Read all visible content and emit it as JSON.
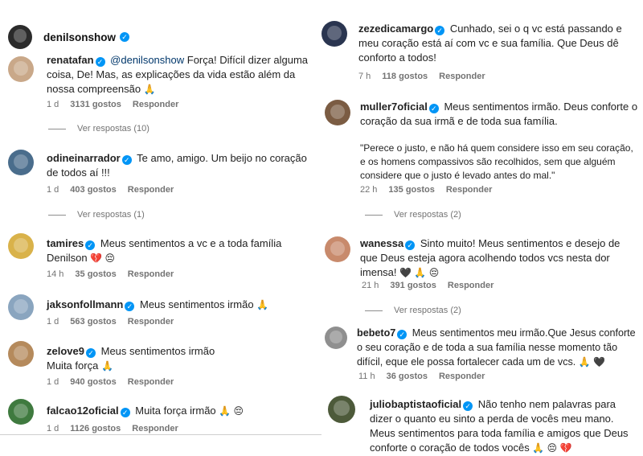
{
  "colors": {
    "verified": "#0095f6",
    "muted": "#737373",
    "mention": "#00376b"
  },
  "header": {
    "username": "denilsonshow"
  },
  "left": [
    {
      "user": "renatafan",
      "mention": "@denilsonshow",
      "text": " Força! Difícil dizer alguma coisa, De! Mas, as explicações da vida estão além da nossa compreensão",
      "emoji": "🙏",
      "time": "1 d",
      "likes": "3131 gostos",
      "reply": "Responder",
      "view_replies": "Ver respostas (10)"
    },
    {
      "user": "odineinarrador",
      "text": "Te amo, amigo. Um beijo no coração de todos aí !!!",
      "emoji": "",
      "time": "1 d",
      "likes": "403 gostos",
      "reply": "Responder",
      "view_replies": "Ver respostas (1)"
    },
    {
      "user": "tamires",
      "text": "Meus sentimentos a vc e a toda família Denilson",
      "emoji": "💔 😔",
      "time": "14 h",
      "likes": "35 gostos",
      "reply": "Responder"
    },
    {
      "user": "jaksonfollmann",
      "text": "Meus sentimentos irmão",
      "emoji": "🙏",
      "time": "1 d",
      "likes": "563 gostos",
      "reply": "Responder"
    },
    {
      "user": "zelove9",
      "text": "Meus sentimentos irmão",
      "text2": "Muita força",
      "emoji": "🙏",
      "time": "1 d",
      "likes": "940 gostos",
      "reply": "Responder"
    },
    {
      "user": "falcao12oficial",
      "text": "Muita força irmão",
      "emoji": "🙏 😔",
      "time": "1 d",
      "likes": "1126 gostos",
      "reply": "Responder"
    }
  ],
  "right": [
    {
      "user": "zezedicamargo",
      "text": "Cunhado, sei o q vc está passando e meu coração está aí com vc e sua família. Que Deus dê conforto a todos!",
      "emoji": "",
      "time": "7 h",
      "likes": "118 gostos",
      "reply": "Responder"
    },
    {
      "user": "muller7oficial",
      "text": "Meus sentimentos irmão. Deus conforte o coração da sua irmã e de toda sua família.",
      "quote": "\"Perece o justo, e não há quem considere isso em seu coração, e os homens compassivos são recolhidos, sem que alguém considere que o justo é levado antes do mal.\"",
      "emoji": "",
      "time": "22 h",
      "likes": "135 gostos",
      "reply": "Responder",
      "view_replies": "Ver respostas (2)"
    },
    {
      "user": "wanessa",
      "text": "Sinto muito! Meus sentimentos e desejo de que Deus esteja agora acolhendo todos vcs nesta dor imensa!",
      "emoji": "🖤 🙏 😔",
      "time": "21 h",
      "likes": "391 gostos",
      "reply": "Responder",
      "view_replies": "Ver respostas (2)"
    },
    {
      "user": "bebeto7",
      "text": "Meus sentimentos meu irmão.Que Jesus conforte o seu coração e de toda a sua família nesse momento tão difícil, eque ele possa fortalecer cada um de vcs.",
      "emoji": "🙏 🖤",
      "time": "11 h",
      "likes": "36 gostos",
      "reply": "Responder"
    },
    {
      "user": "juliobaptistaoficial",
      "text": "Não tenho nem palavras para dizer o quanto eu sinto a perda de vocês meu mano. Meus sentimentos para toda família e amigos que Deus conforte o coração de todos vocês",
      "emoji": "🙏 😔 💔",
      "time": "",
      "likes": "",
      "reply": ""
    }
  ]
}
